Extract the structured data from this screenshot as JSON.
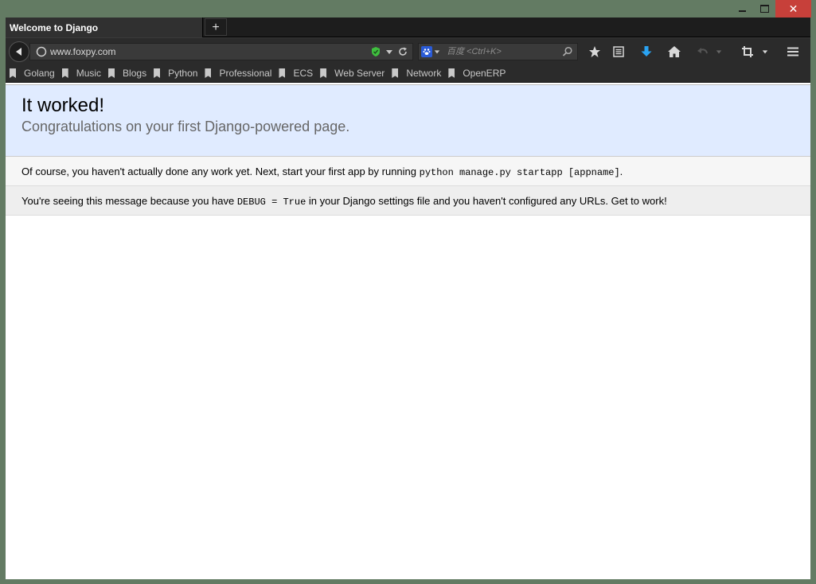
{
  "window": {
    "minimize_label": "",
    "maximize_label": "",
    "close_label": "✕"
  },
  "tabs": [
    {
      "title": "Welcome to Django"
    }
  ],
  "newtab_label": "+",
  "navbar": {
    "url": "www.foxpy.com",
    "search_placeholder": "百度 <Ctrl+K>"
  },
  "icons": {
    "back": "back-arrow-icon",
    "identity": "globe-icon",
    "shield": "shield-icon",
    "reload": "reload-icon",
    "search_engine": "baidu-paw-icon",
    "search": "magnifier-icon",
    "bookmark_star": "star-icon",
    "bookmarks_menu": "bookmarks-list-icon",
    "downloads": "download-arrow-icon",
    "home": "home-icon",
    "undo": "undo-icon",
    "crop": "crop-icon",
    "menu": "hamburger-icon"
  },
  "colors": {
    "download_accent": "#2aa3f2",
    "shield_green": "#3fbf3f",
    "close_red": "#c7403a",
    "summary_bg": "#e0ebff"
  },
  "bookmarks": [
    {
      "label": "Golang"
    },
    {
      "label": "Music"
    },
    {
      "label": "Blogs"
    },
    {
      "label": "Python"
    },
    {
      "label": "Professional"
    },
    {
      "label": "ECS"
    },
    {
      "label": "Web Server"
    },
    {
      "label": "Network"
    },
    {
      "label": "OpenERP"
    }
  ],
  "page": {
    "heading": "It worked!",
    "subheading": "Congratulations on your first Django-powered page.",
    "instructions_prefix": "Of course, you haven't actually done any work yet. Next, start your first app by running ",
    "instructions_code": "python manage.py startapp [appname]",
    "instructions_suffix": ".",
    "explanation_prefix": "You're seeing this message because you have ",
    "explanation_code": "DEBUG = True",
    "explanation_suffix": " in your Django settings file and you haven't configured any URLs. Get to work!"
  }
}
